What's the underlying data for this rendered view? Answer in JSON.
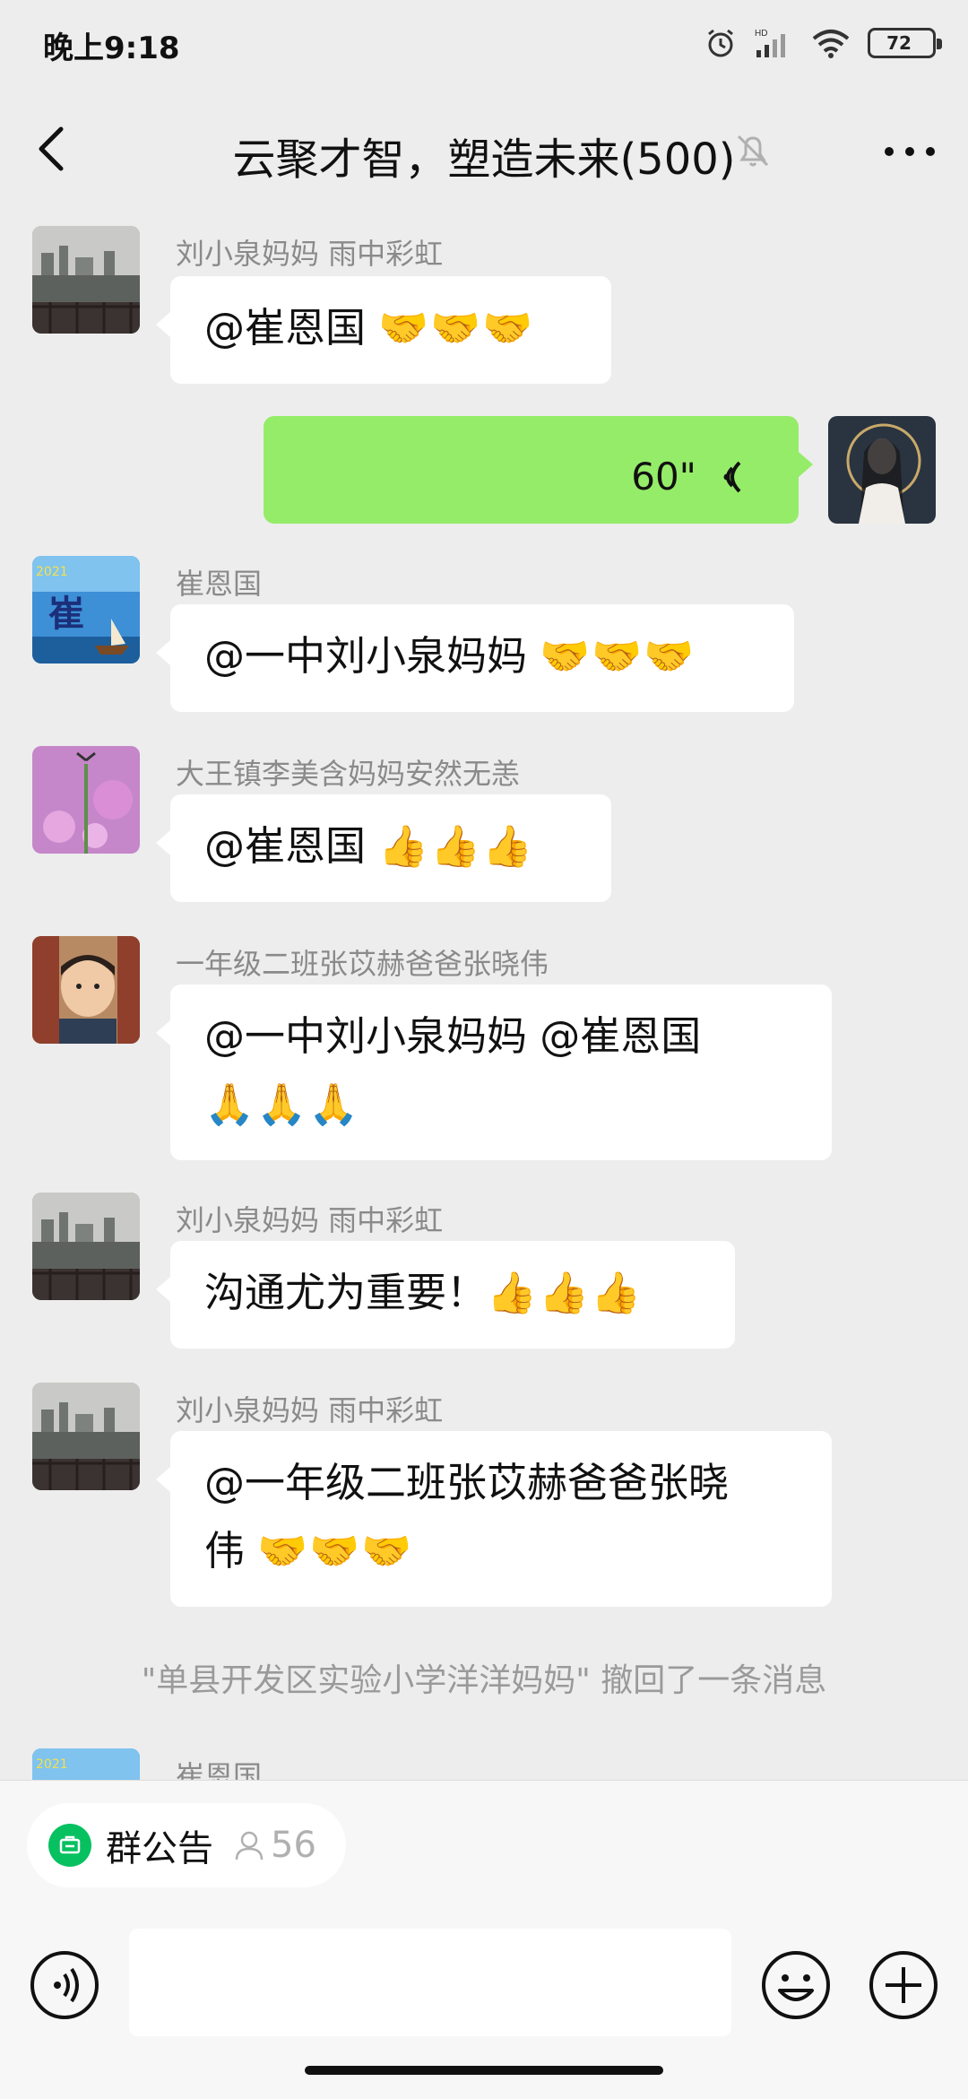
{
  "status": {
    "time": "晚上9:18",
    "battery": "72"
  },
  "header": {
    "title": "云聚才智，塑造未来(500)"
  },
  "messages": [
    {
      "sender": "刘小泉妈妈  雨中彩虹",
      "text": "@崔恩国 ",
      "emoji": "🤝🤝🤝"
    },
    {
      "voice_duration": "60\""
    },
    {
      "sender": "崔恩国",
      "text": "@一中刘小泉妈妈 ",
      "emoji": "🤝🤝🤝"
    },
    {
      "sender": "大王镇李美含妈妈安然无恙",
      "text": "@崔恩国 ",
      "emoji": "👍👍👍"
    },
    {
      "sender": "一年级二班张苡赫爸爸张晓伟",
      "line1": "@一中刘小泉妈妈 @崔恩国",
      "emoji": "🙏🙏🙏"
    },
    {
      "sender": "刘小泉妈妈  雨中彩虹",
      "text": "沟通尤为重要！",
      "emoji": "👍👍👍"
    },
    {
      "sender": "刘小泉妈妈  雨中彩虹",
      "line1": "@一年级二班张苡赫爸爸张晓",
      "line2": "伟 ",
      "emoji": "🤝🤝🤝"
    },
    {
      "sender": "崔恩国"
    }
  ],
  "system_note": "\"单县开发区实验小学洋洋妈妈\" 撤回了一条消息",
  "bottom": {
    "notice_label": "群公告",
    "member_count": "56"
  },
  "colors": {
    "accent": "#07c160",
    "my_bubble": "#95ec69",
    "background": "#ededed"
  }
}
